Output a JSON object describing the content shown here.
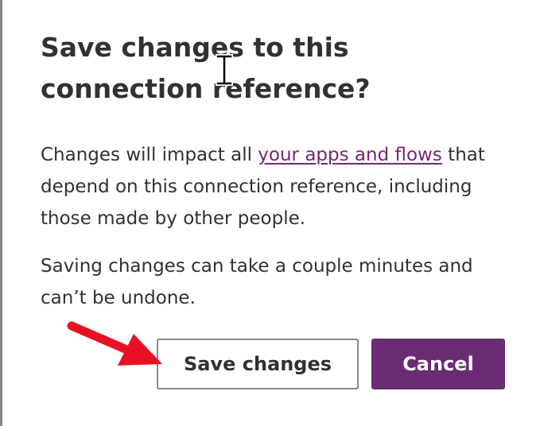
{
  "dialog": {
    "title": "Save changes to this connection reference?",
    "paragraph1": {
      "before_link": "Changes will impact all ",
      "link_text": "your apps and flows",
      "after_link": " that depend on this connection reference, including those made by other people."
    },
    "paragraph2": "Saving changes can take a couple minutes and can’t be undone.",
    "buttons": {
      "save_label": "Save changes",
      "cancel_label": "Cancel"
    }
  },
  "colors": {
    "primary": "#6a2c72",
    "link": "#742774",
    "annotation_arrow": "#e81123"
  },
  "icons": {
    "cursor": "text-cursor-icon",
    "annotation": "red-arrow-icon"
  }
}
